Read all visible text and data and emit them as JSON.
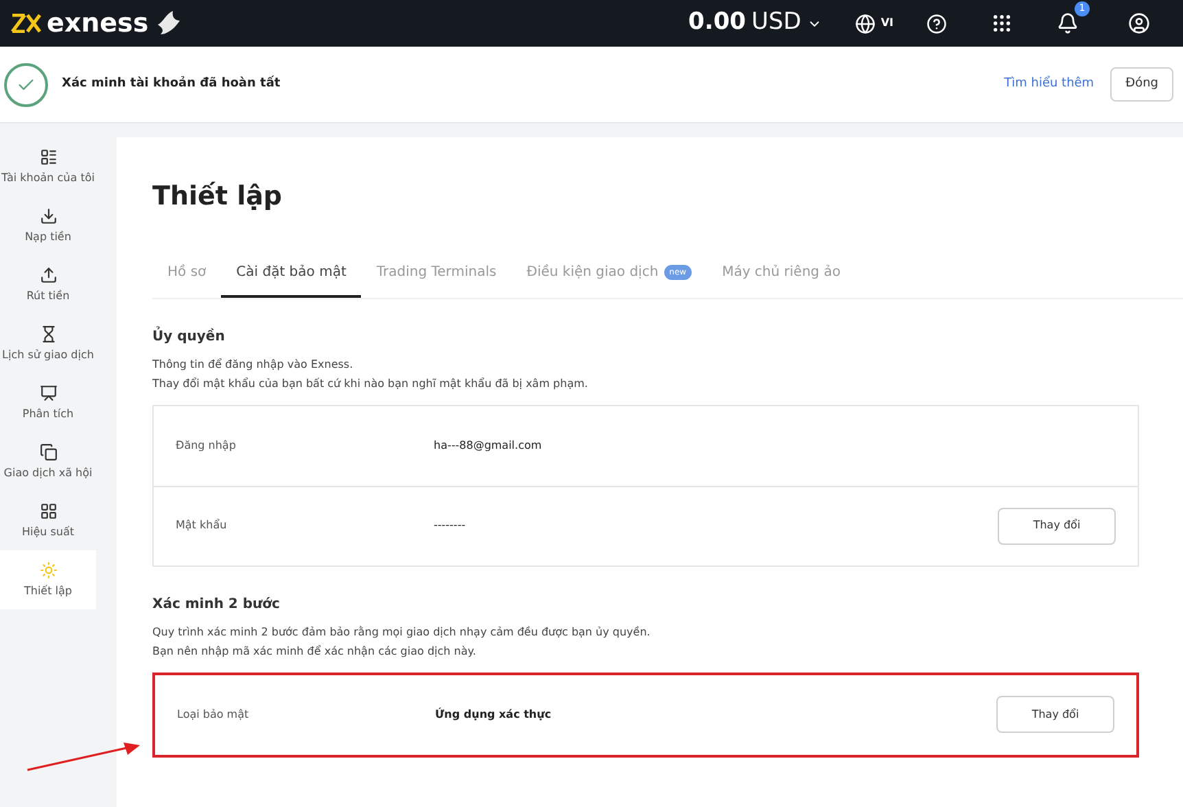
{
  "header": {
    "logo": "exness",
    "balance": "0.00",
    "currency": "USD",
    "language": "VI",
    "notification_count": "1"
  },
  "banner": {
    "message": "Xác minh tài khoản đã hoàn tất",
    "link": "Tìm hiểu thêm",
    "close_button": "Đóng"
  },
  "sidebar": {
    "items": [
      {
        "label": "Tài khoản của tôi",
        "kind": "accounts",
        "selected": false
      },
      {
        "label": "Nạp tiền",
        "kind": "deposit",
        "selected": false
      },
      {
        "label": "Rút tiền",
        "kind": "withdraw",
        "selected": false
      },
      {
        "label": "Lịch sử giao dịch",
        "kind": "history",
        "selected": false
      },
      {
        "label": "Phân tích",
        "kind": "analytics",
        "selected": false
      },
      {
        "label": "Giao dịch xã hội",
        "kind": "social",
        "selected": false
      },
      {
        "label": "Hiệu suất",
        "kind": "performance",
        "selected": false
      },
      {
        "label": "Thiết lập",
        "kind": "settings",
        "selected": true
      }
    ]
  },
  "page_title": "Thiết lập",
  "tabs": [
    {
      "label": "Hồ sơ",
      "selected": false
    },
    {
      "label": "Cài đặt bảo mật",
      "selected": true
    },
    {
      "label": "Trading Terminals",
      "selected": false
    },
    {
      "label": "Điều kiện giao dịch",
      "selected": false,
      "badge": "new"
    },
    {
      "label": "Máy chủ riêng ảo",
      "selected": false
    }
  ],
  "sections": [
    {
      "title": "Ủy quyền",
      "description": [
        "Thông tin để đăng nhập vào Exness.",
        "Thay đổi mật khẩu của bạn bất cứ khi nào bạn nghĩ mật khẩu đã bị xâm phạm."
      ],
      "highlighted": false,
      "rows": [
        {
          "label": "Đăng nhập",
          "value": "ha---88@gmail.com"
        },
        {
          "label": "Mật khẩu",
          "value": "--------",
          "button": "Thay đổi"
        }
      ]
    },
    {
      "title": "Xác minh 2 bước",
      "description": [
        "Quy trình xác minh 2 bước đảm bảo rằng mọi giao dịch nhạy cảm đều được bạn ủy quyền.",
        "Bạn nên nhập mã xác minh để xác nhận các giao dịch này."
      ],
      "highlighted": true,
      "rows": [
        {
          "label": "Loại bảo mật",
          "value": "Ứng dụng xác thực",
          "value_bold": true,
          "button": "Thay đổi"
        }
      ]
    }
  ]
}
